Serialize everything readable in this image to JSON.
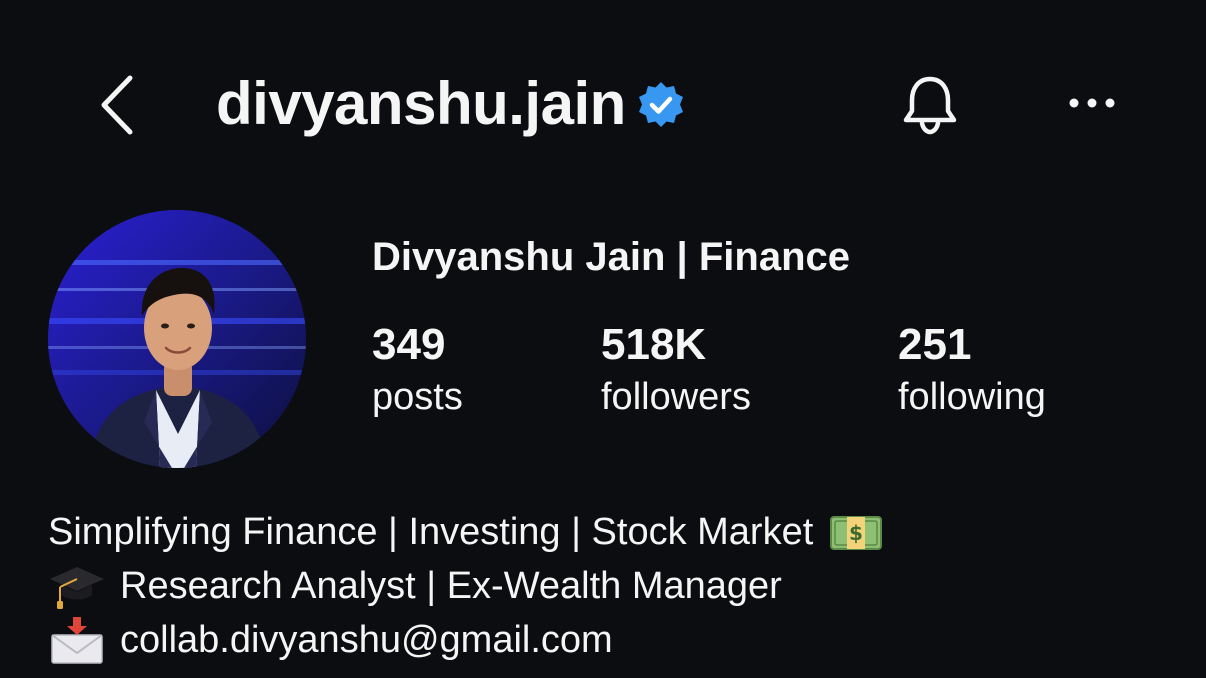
{
  "header": {
    "username": "divyanshu.jain",
    "verified": true,
    "verified_color": "#3897f0",
    "icons": {
      "back": "chevron-left-icon",
      "notifications": "bell-icon",
      "more": "more-horizontal-icon"
    }
  },
  "profile": {
    "display_name": "Divyanshu Jain | Finance",
    "stats": {
      "posts": {
        "value": "349",
        "label": "posts"
      },
      "followers": {
        "value": "518K",
        "label": "followers"
      },
      "following": {
        "value": "251",
        "label": "following"
      }
    }
  },
  "bio": {
    "line1": "Simplifying Finance | Investing | Stock Market",
    "line1_emoji": "money-bill-icon",
    "line2": "Research Analyst | Ex-Wealth Manager",
    "line2_emoji": "graduation-cap-icon",
    "line3": "collab.divyanshu@gmail.com",
    "line3_emoji": "incoming-envelope-icon"
  }
}
